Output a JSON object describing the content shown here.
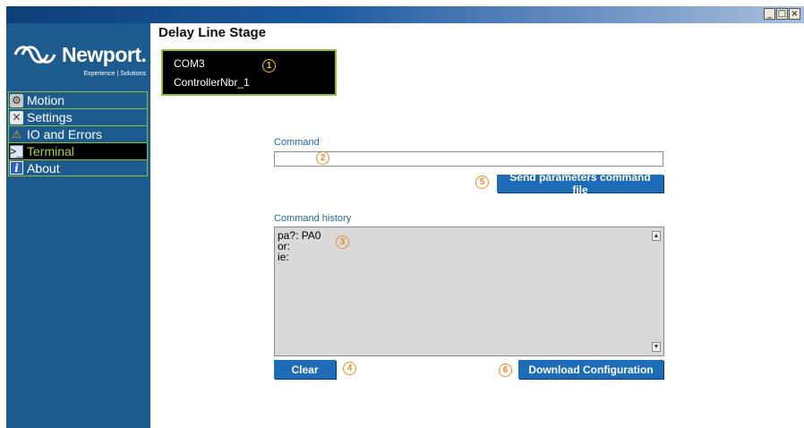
{
  "window": {
    "minimize_glyph": "_",
    "maximize_glyph": "□",
    "close_glyph": "×"
  },
  "brand": {
    "name": "Newport.",
    "tagline": "Experience | Solutions"
  },
  "sidebar": {
    "items": [
      {
        "label": "Motion",
        "icon": "motion-icon",
        "active": false
      },
      {
        "label": "Settings",
        "icon": "settings-icon",
        "active": false
      },
      {
        "label": "IO and Errors",
        "icon": "warning-icon",
        "active": false
      },
      {
        "label": "Terminal",
        "icon": "terminal-icon",
        "active": true
      },
      {
        "label": "About",
        "icon": "info-icon",
        "active": false
      }
    ]
  },
  "page": {
    "title": "Delay Line Stage"
  },
  "controller": {
    "port": "COM3",
    "name": "ControllerNbr_1"
  },
  "command": {
    "label": "Command",
    "value": "",
    "send_file_label": "Send parameters command file"
  },
  "history": {
    "label": "Command history",
    "lines": [
      "pa?: PA0",
      "or:",
      "ie:"
    ]
  },
  "actions": {
    "clear_label": "Clear",
    "download_label": "Download Configuration"
  },
  "badges": [
    "1",
    "2",
    "3",
    "4",
    "5",
    "6"
  ],
  "colors": {
    "sidebar_bg": "#1d5b8f",
    "nav_border": "#8fbf3a",
    "active_text": "#a7d044",
    "button_bg": "#1e6bb8",
    "label_blue": "#1e66ad",
    "badge_orange": "#f08a24"
  }
}
